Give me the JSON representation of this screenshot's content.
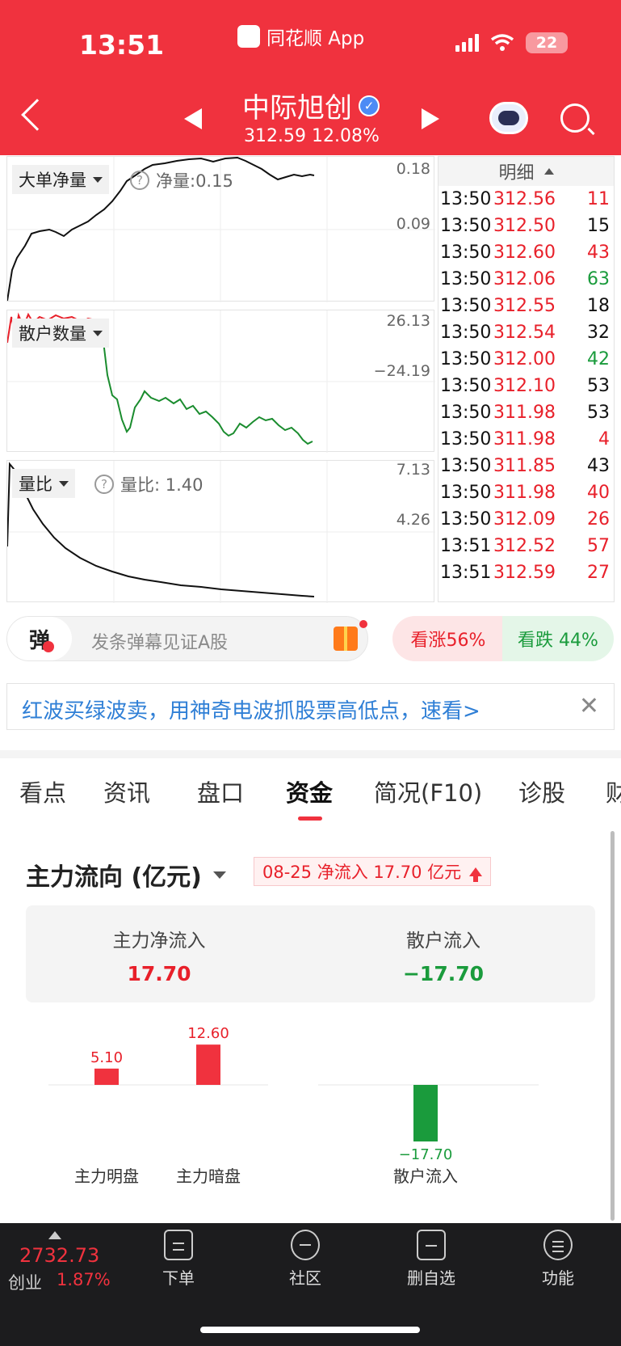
{
  "status_bar": {
    "time": "13:51",
    "app_name": "同花顺 App",
    "battery": "22"
  },
  "header": {
    "stock_name": "中际旭创",
    "price": "312.59",
    "change_pct": "12.08%"
  },
  "charts": {
    "top": {
      "selector": "大单净量",
      "info_label": "净量:0.15",
      "axis_top": "0.18",
      "axis_mid": "0.09"
    },
    "middle": {
      "selector": "散户数量",
      "axis_top": "26.13",
      "axis_mid": "−24.19"
    },
    "bottom": {
      "selector": "量比",
      "info_label": "量比: 1.40",
      "axis_top": "7.13",
      "axis_mid": "4.26"
    }
  },
  "detail": {
    "header": "明细",
    "rows": [
      {
        "time": "13:50",
        "price": "312.56",
        "vol": "11",
        "vol_color": "#e8202a"
      },
      {
        "time": "13:50",
        "price": "312.50",
        "vol": "15",
        "vol_color": "#111111"
      },
      {
        "time": "13:50",
        "price": "312.60",
        "vol": "43",
        "vol_color": "#e8202a"
      },
      {
        "time": "13:50",
        "price": "312.06",
        "vol": "63",
        "vol_color": "#1a9b3c"
      },
      {
        "time": "13:50",
        "price": "312.55",
        "vol": "18",
        "vol_color": "#111111"
      },
      {
        "time": "13:50",
        "price": "312.54",
        "vol": "32",
        "vol_color": "#111111"
      },
      {
        "time": "13:50",
        "price": "312.00",
        "vol": "42",
        "vol_color": "#1a9b3c"
      },
      {
        "time": "13:50",
        "price": "312.10",
        "vol": "53",
        "vol_color": "#111111"
      },
      {
        "time": "13:50",
        "price": "311.98",
        "vol": "53",
        "vol_color": "#111111"
      },
      {
        "time": "13:50",
        "price": "311.98",
        "vol": "4",
        "vol_color": "#e8202a"
      },
      {
        "time": "13:50",
        "price": "311.85",
        "vol": "43",
        "vol_color": "#111111"
      },
      {
        "time": "13:50",
        "price": "311.98",
        "vol": "40",
        "vol_color": "#e8202a"
      },
      {
        "time": "13:50",
        "price": "312.09",
        "vol": "26",
        "vol_color": "#e8202a"
      },
      {
        "time": "13:51",
        "price": "312.52",
        "vol": "57",
        "vol_color": "#e8202a"
      },
      {
        "time": "13:51",
        "price": "312.59",
        "vol": "27",
        "vol_color": "#e8202a"
      }
    ]
  },
  "danmu": {
    "badge": "弹",
    "placeholder": "发条弹幕见证A股",
    "vote_up": "看涨56%",
    "vote_down": "看跌 44%"
  },
  "banner": {
    "text": "红波买绿波卖，用神奇电波抓股票高低点，速看>",
    "close": "✕"
  },
  "tabs": [
    "看点",
    "资讯",
    "盘口",
    "资金",
    "简况(F10)",
    "诊股",
    "财"
  ],
  "flow": {
    "title": "主力流向 (亿元)",
    "badge": "08-25 净流入 17.70 亿元",
    "main_net_label": "主力净流入",
    "main_net_value": "17.70",
    "retail_label": "散户流入",
    "retail_value": "−17.70"
  },
  "chart_data": {
    "type": "bar",
    "categories": [
      "主力明盘",
      "主力暗盘",
      "散户流入"
    ],
    "values": [
      5.1,
      12.6,
      -17.7
    ],
    "value_labels": [
      "5.10",
      "12.60",
      "−17.70"
    ],
    "colors": [
      "#f0323e",
      "#f0323e",
      "#1a9b3c"
    ]
  },
  "bottom_nav": {
    "index_value": "2732.73",
    "index_name": "创业",
    "index_pct": "1.87%",
    "items": [
      "下单",
      "社区",
      "删自选",
      "功能"
    ]
  },
  "colors": {
    "header_red": "#f0323e",
    "up_red": "#e8202a",
    "down_green": "#1a9b3c"
  }
}
